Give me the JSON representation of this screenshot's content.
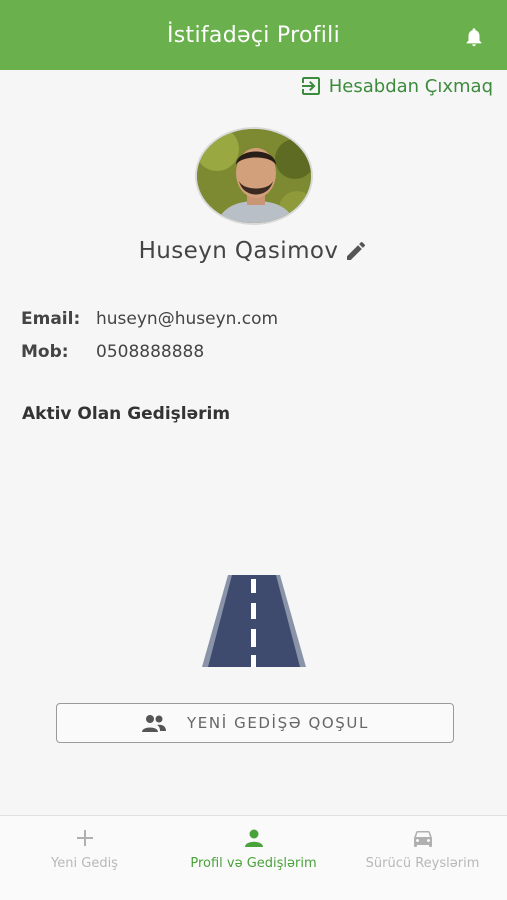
{
  "header": {
    "title": "İstifadəçi Profili",
    "icon": "bell-icon"
  },
  "logout": {
    "label": "Hesabdan Çıxmaq",
    "icon": "logout-icon"
  },
  "profile": {
    "name": "Huseyn Qasimov",
    "email_label": "Email:",
    "email": "huseyn@huseyn.com",
    "mob_label": "Mob:",
    "mob": "0508888888"
  },
  "section": {
    "active_trips_title": "Aktiv Olan Gedişlərim"
  },
  "join_button": {
    "label": "YENİ GEDİŞƏ QOŞUL",
    "icon": "people-icon"
  },
  "bottom_nav": {
    "items": [
      {
        "label": "Yeni Gediş",
        "icon": "plus-icon",
        "active": false
      },
      {
        "label": "Profil və Gedişlərim",
        "icon": "person-icon",
        "active": true
      },
      {
        "label": "Sürücü Reyslərim",
        "icon": "car-icon",
        "active": false
      }
    ]
  },
  "colors": {
    "primary": "#6ab04c",
    "accent_text": "#3d8b3d",
    "active_nav": "#4aa23a"
  }
}
